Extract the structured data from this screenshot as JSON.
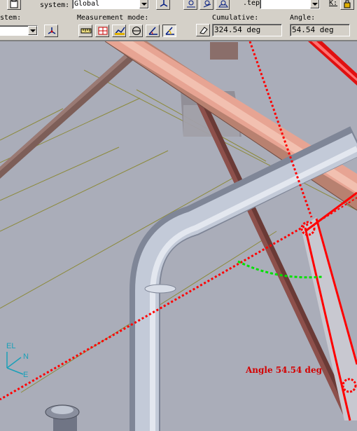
{
  "toolbar": {
    "row1": {
      "system_label": "system:",
      "system_value": "Global",
      "step_label": ".tep:",
      "step_value": "",
      "k_label": "K:"
    },
    "row2": {
      "system_label": "stem:",
      "system_value": "",
      "mode_label": "Measurement mode:",
      "cumulative_label": "Cumulative:",
      "cumulative_value": "324.54 deg",
      "angle_label": "Angle:",
      "angle_value": "54.54 deg"
    },
    "mode_buttons": [
      {
        "icon": "ruler-icon",
        "active": false
      },
      {
        "icon": "grid-snap-icon",
        "active": false
      },
      {
        "icon": "chart-measure-icon",
        "active": false
      },
      {
        "icon": "circle-measure-icon",
        "active": false
      },
      {
        "icon": "angle-measure-icon",
        "active": false
      },
      {
        "icon": "cumulative-angle-icon",
        "active": true
      }
    ]
  },
  "viewport": {
    "annotation": "Angle 54.54 deg",
    "axis_labels": {
      "el": "EL",
      "n": "N",
      "e": "E"
    }
  },
  "colors": {
    "background": "#aaadb9",
    "measure_line": "#ff0000",
    "arc": "#00e000",
    "beam": "#e7a493",
    "pipe": "#c3cad8",
    "grid": "#8c8a3a"
  }
}
